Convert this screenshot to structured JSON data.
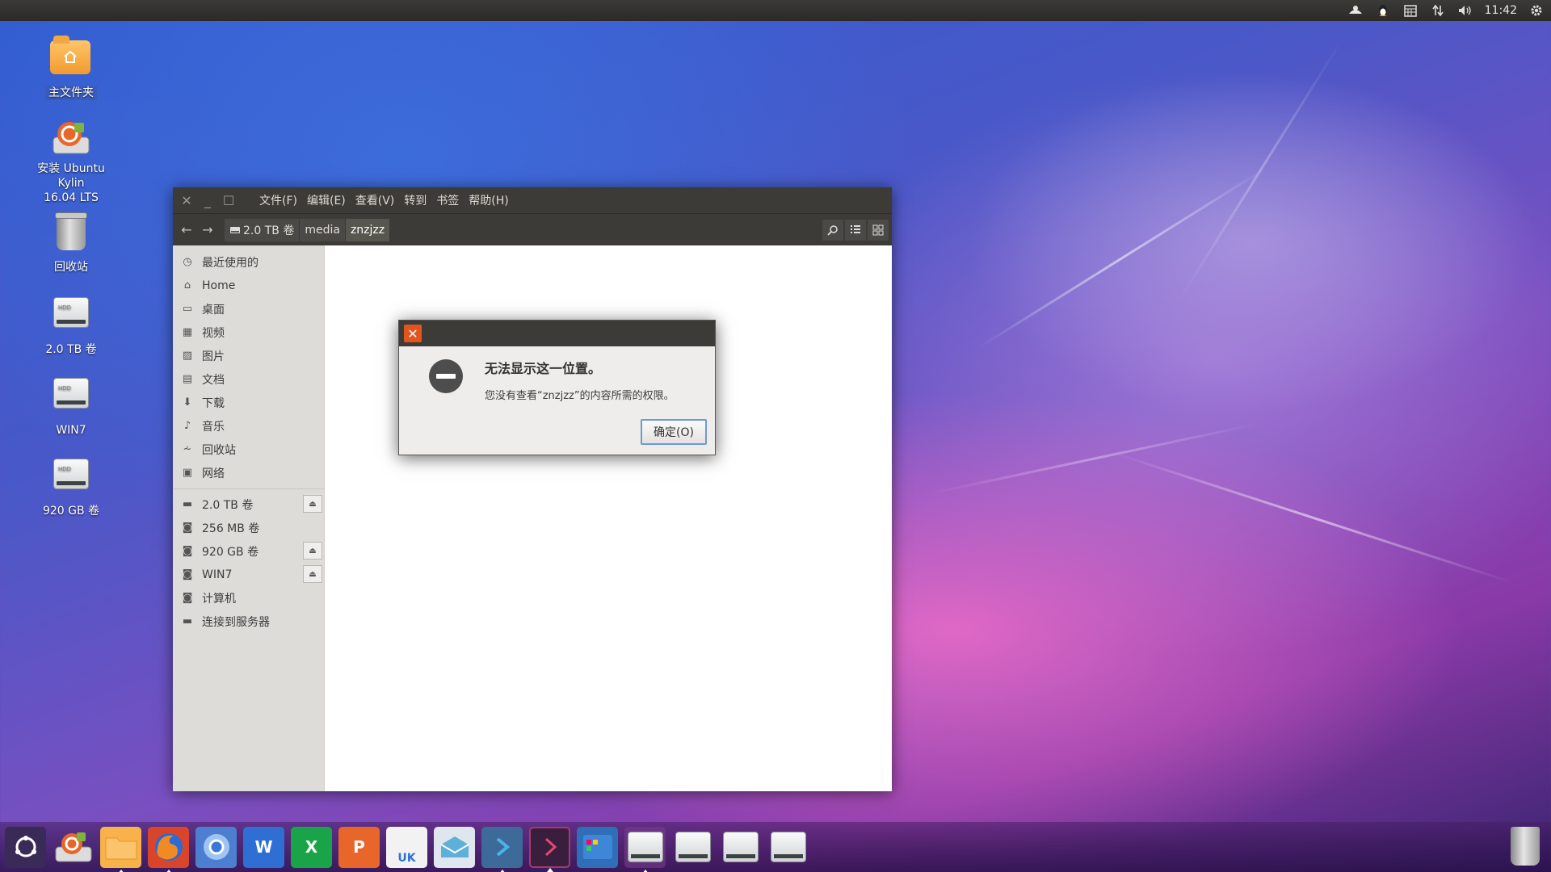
{
  "top_panel": {
    "clock": "11:42",
    "indicators": [
      "kylin-indicator-icon",
      "qq-penguin-icon",
      "calendar-icon",
      "network-arrows-icon",
      "volume-icon",
      "gear-icon"
    ]
  },
  "desktop": {
    "icons": [
      {
        "label": "主文件夹",
        "icon": "home-folder-icon"
      },
      {
        "label": "安装 Ubuntu Kylin",
        "label2": "16.04 LTS",
        "icon": "installer-icon"
      },
      {
        "label": "回收站",
        "icon": "trash-icon"
      },
      {
        "label": "2.0 TB 卷",
        "icon": "hdd-icon"
      },
      {
        "label": "WIN7",
        "icon": "hdd-icon"
      },
      {
        "label": "920 GB 卷",
        "icon": "hdd-icon"
      }
    ],
    "hdd_label": "HDD"
  },
  "file_manager": {
    "menu": [
      "文件(F)",
      "编辑(E)",
      "查看(V)",
      "转到",
      "书签",
      "帮助(H)"
    ],
    "breadcrumbs": [
      "2.0 TB 卷",
      "media",
      "znzjzz"
    ],
    "sidebar_places": [
      {
        "label": "最近使用的",
        "icon": "clock-icon"
      },
      {
        "label": "Home",
        "icon": "home-icon"
      },
      {
        "label": "桌面",
        "icon": "desktop-icon"
      },
      {
        "label": "视频",
        "icon": "video-icon"
      },
      {
        "label": "图片",
        "icon": "picture-icon"
      },
      {
        "label": "文档",
        "icon": "document-icon"
      },
      {
        "label": "下载",
        "icon": "download-icon"
      },
      {
        "label": "音乐",
        "icon": "music-icon"
      },
      {
        "label": "回收站",
        "icon": "trash-icon"
      },
      {
        "label": "网络",
        "icon": "network-icon"
      }
    ],
    "sidebar_devices": [
      {
        "label": "2.0 TB 卷",
        "icon": "drive-icon",
        "eject": true
      },
      {
        "label": "256 MB 卷",
        "icon": "drive-icon",
        "eject": false
      },
      {
        "label": "920 GB 卷",
        "icon": "drive-icon",
        "eject": true
      },
      {
        "label": "WIN7",
        "icon": "drive-icon",
        "eject": true
      },
      {
        "label": "计算机",
        "icon": "computer-icon",
        "eject": false
      },
      {
        "label": "连接到服务器",
        "icon": "server-icon",
        "eject": false
      }
    ]
  },
  "dialog": {
    "title": "无法显示这一位置。",
    "message": "您没有查看“znzjzz”的内容所需的权限。",
    "ok_label": "确定(O)"
  },
  "dock": {
    "items": [
      {
        "name": "dash-home-icon",
        "running": false
      },
      {
        "name": "installer-icon",
        "running": false
      },
      {
        "name": "files-icon",
        "running": true
      },
      {
        "name": "firefox-icon",
        "running": true
      },
      {
        "name": "chromium-icon",
        "running": false
      },
      {
        "name": "wps-writer-icon",
        "running": false
      },
      {
        "name": "wps-spreadsheet-icon",
        "running": false
      },
      {
        "name": "wps-presentation-icon",
        "running": false
      },
      {
        "name": "software-center-icon",
        "running": false
      },
      {
        "name": "mail-icon",
        "running": false
      },
      {
        "name": "terminal-blue-icon",
        "running": true
      },
      {
        "name": "terminal-red-icon",
        "running": true
      },
      {
        "name": "workspace-switcher-icon",
        "running": false
      },
      {
        "name": "hdd-dock-icon",
        "running": true
      },
      {
        "name": "hdd-dock-icon",
        "running": false
      },
      {
        "name": "hdd-dock-icon",
        "running": false
      },
      {
        "name": "hdd-dock-icon",
        "running": false
      }
    ],
    "wps_letters": {
      "writer": "W",
      "spreadsheet": "X",
      "presentation": "P"
    },
    "uk_label": "UK"
  },
  "colors": {
    "accent_orange": "#e2551f",
    "panel_dark": "#3c3b37",
    "button_focus": "#6f9ad0"
  }
}
